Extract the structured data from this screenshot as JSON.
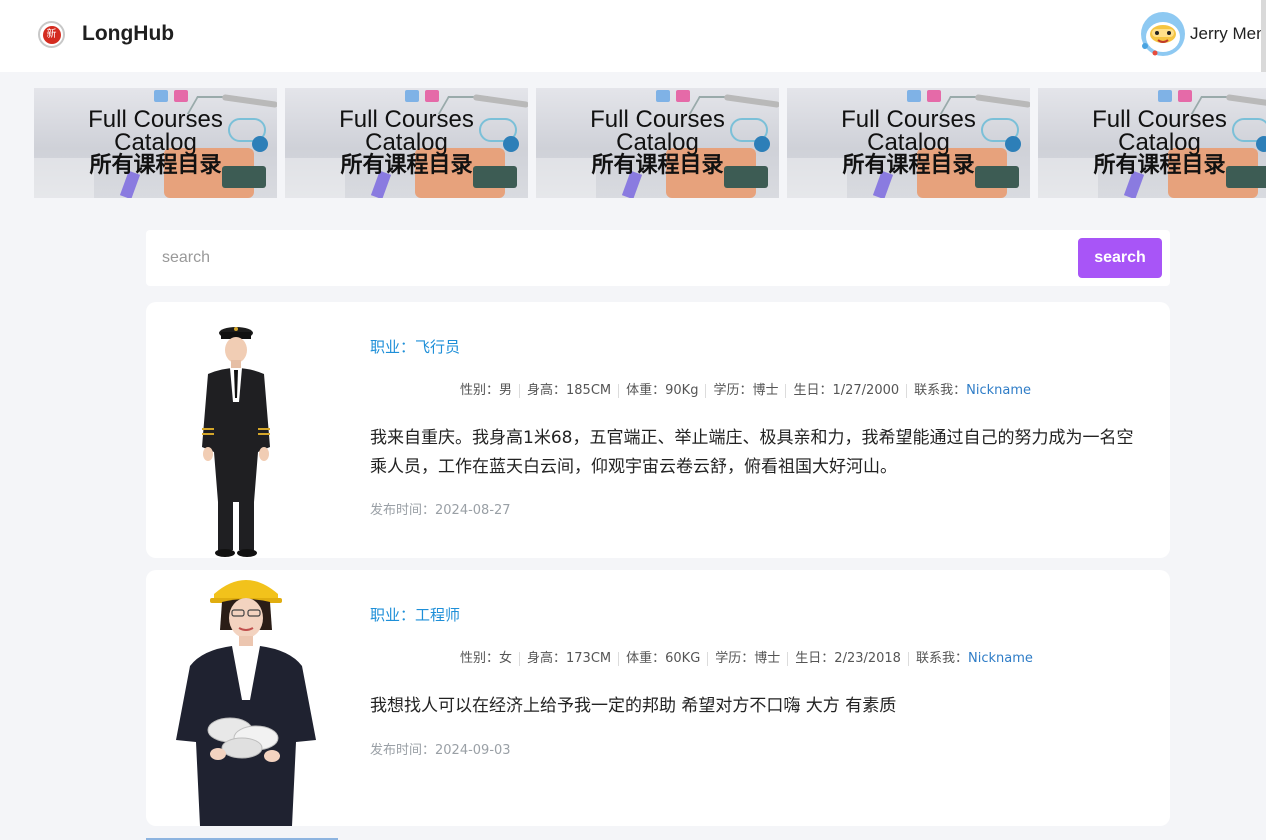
{
  "header": {
    "brand": "LongHub",
    "user_name": "Jerry Men"
  },
  "banners": [
    {
      "line1": "Full Courses",
      "line2": "Catalog",
      "line3": "所有课程目录"
    },
    {
      "line1": "Full Courses",
      "line2": "Catalog",
      "line3": "所有课程目录"
    },
    {
      "line1": "Full Courses",
      "line2": "Catalog",
      "line3": "所有课程目录"
    },
    {
      "line1": "Full Courses",
      "line2": "Catalog",
      "line3": "所有课程目录"
    },
    {
      "line1": "Full Courses",
      "line2": "Catalog",
      "line3": "所有课程目录"
    }
  ],
  "search": {
    "placeholder": "search",
    "value": "",
    "button_label": "search"
  },
  "profiles": [
    {
      "occupation": "职业：飞行员",
      "gender": "性别：男",
      "height": "身高：185CM",
      "weight": "体重：90Kg",
      "education": "学历：博士",
      "birthday": "生日：1/27/2000",
      "contact_label": "联系我：",
      "contact_link": "Nickname",
      "bio": "我来自重庆。我身高1米68，五官端正、举止端庄、极具亲和力，我希望能通过自己的努力成为一名空乘人员，工作在蓝天白云间，仰观宇宙云卷云舒，俯看祖国大好河山。",
      "posted": "发布时间：2024-08-27"
    },
    {
      "occupation": "职业：工程师",
      "gender": "性别：女",
      "height": "身高：173CM",
      "weight": "体重：60KG",
      "education": "学历：博士",
      "birthday": "生日：2/23/2018",
      "contact_label": "联系我：",
      "contact_link": "Nickname",
      "bio": "我想找人可以在经济上给予我一定的邦助 希望对方不口嗨 大方 有素质",
      "posted": "发布时间：2024-09-03"
    }
  ],
  "colors": {
    "accent": "#a855f7",
    "link": "#1e8fd8",
    "background": "#f4f5f8"
  }
}
